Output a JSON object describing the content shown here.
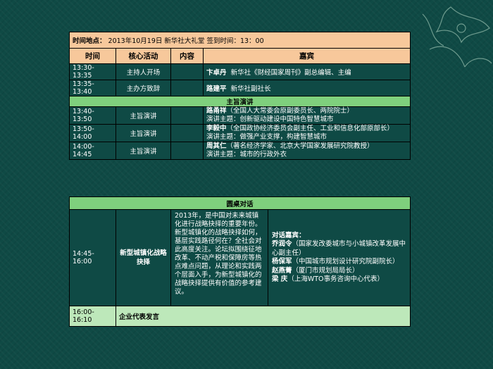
{
  "header": {
    "label": "时间地点：",
    "info": "2013年10月19日  新华社大礼堂  签到时间：13：00"
  },
  "columns": [
    "时间",
    "核心活动",
    "内容",
    "嘉宾"
  ],
  "rows1": [
    {
      "time": "13:30-13:35",
      "activity": "主持人开场",
      "guest_name": "卞卓丹",
      "guest_title": "新华社《财经国家周刊》副总编辑、主编"
    },
    {
      "time": "13:35-13:40",
      "activity": "主办方致辞",
      "guest_name": "路建平",
      "guest_title": "新华社副社长"
    }
  ],
  "section_keynote": "主旨演讲",
  "rows2": [
    {
      "time": "13:40-13:50",
      "activity": "主旨演讲",
      "guest_name": "路甬祥",
      "guest_title": "（全国人大常委会原副委员长、两院院士）",
      "topic": "演讲主题：创新驱动建设中国特色智慧城市"
    },
    {
      "time": "13:50-14:00",
      "activity": "主旨演讲",
      "guest_name": "李毅中",
      "guest_title": "（全国政协经济委员会副主任、工业和信息化部原部长）",
      "topic": "演讲主题：做强产业支撑，构建智慧城市"
    },
    {
      "time": "14:00-14:45",
      "activity": "主旨演讲",
      "guest_name": "周其仁",
      "guest_title": "（著名经济学家、北京大学国家发展研究院教授）",
      "topic": "演讲主题：城市的行政外衣"
    }
  ],
  "section_round": "圆桌对话",
  "round": {
    "time": "14:45-16:00",
    "activity": "新型城镇化战略抉择",
    "description": "2013年，是中国对未来城镇化进行战略抉择的重要年份。新型城镇化的战略抉择如何，基层实践路径何在？全社会对此高度关注。论坛拟围绕征地改革、不动产税和保障房等热点难点问题，从理论和实践两个层面入手，为新型城镇化的战略抉择提供有价值的参考建议。",
    "guests_label": "对话嘉宾：",
    "guests": [
      {
        "name": "乔润令",
        "title": "（国家发改委城市与小城镇改革发展中心副主任）"
      },
      {
        "name": "杨保军",
        "title": "（中国城市规划设计研究院副院长）"
      },
      {
        "name": "赵燕菁",
        "title": "（厦门市规划局局长）"
      },
      {
        "name": "梁  庆",
        "title": "（上海WTO事务咨询中心代表）"
      }
    ]
  },
  "final_row": {
    "time": "16:00-16:10",
    "activity": "企业代表发言"
  }
}
